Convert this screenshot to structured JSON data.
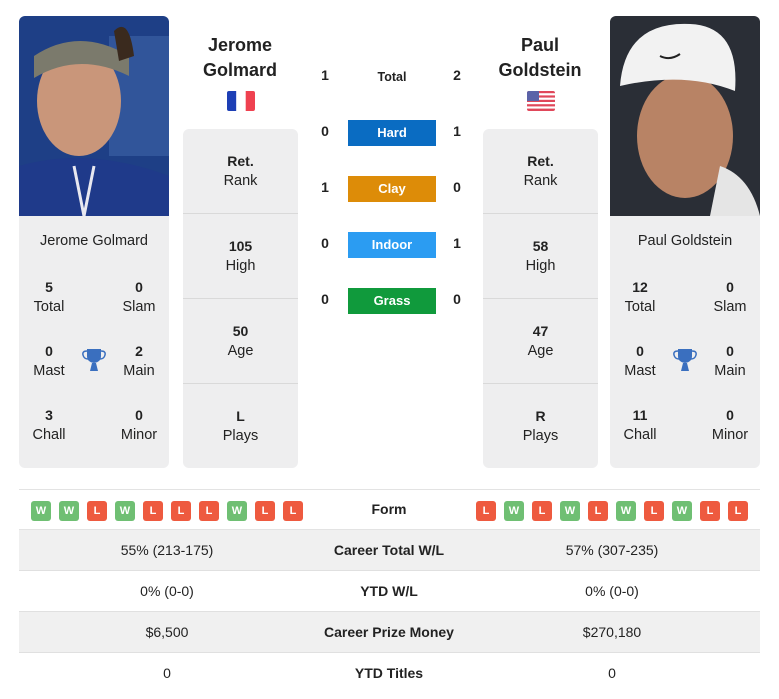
{
  "player1": {
    "name_line1": "Jerome",
    "name_line2": "Golmard",
    "full_name": "Jerome Golmard",
    "country_flag": "france-flag",
    "titles": {
      "total": {
        "value": "5",
        "label": "Total"
      },
      "slam": {
        "value": "0",
        "label": "Slam"
      },
      "mast": {
        "value": "0",
        "label": "Mast"
      },
      "main": {
        "value": "2",
        "label": "Main"
      },
      "chall": {
        "value": "3",
        "label": "Chall"
      },
      "minor": {
        "value": "0",
        "label": "Minor"
      }
    },
    "info": [
      {
        "value": "Ret.",
        "label": "Rank"
      },
      {
        "value": "105",
        "label": "High"
      },
      {
        "value": "50",
        "label": "Age"
      },
      {
        "value": "L",
        "label": "Plays"
      }
    ],
    "form": [
      "W",
      "W",
      "L",
      "W",
      "L",
      "L",
      "L",
      "W",
      "L",
      "L"
    ]
  },
  "player2": {
    "name_line1": "Paul",
    "name_line2": "Goldstein",
    "full_name": "Paul Goldstein",
    "country_flag": "usa-flag",
    "titles": {
      "total": {
        "value": "12",
        "label": "Total"
      },
      "slam": {
        "value": "0",
        "label": "Slam"
      },
      "mast": {
        "value": "0",
        "label": "Mast"
      },
      "main": {
        "value": "0",
        "label": "Main"
      },
      "chall": {
        "value": "11",
        "label": "Chall"
      },
      "minor": {
        "value": "0",
        "label": "Minor"
      }
    },
    "info": [
      {
        "value": "Ret.",
        "label": "Rank"
      },
      {
        "value": "58",
        "label": "High"
      },
      {
        "value": "47",
        "label": "Age"
      },
      {
        "value": "R",
        "label": "Plays"
      }
    ],
    "form": [
      "L",
      "W",
      "L",
      "W",
      "L",
      "W",
      "L",
      "W",
      "L",
      "L"
    ]
  },
  "h2h": [
    {
      "surface": "Total",
      "p1": "1",
      "p2": "2",
      "color": ""
    },
    {
      "surface": "Hard",
      "p1": "0",
      "p2": "1",
      "color": "#0a6cc2"
    },
    {
      "surface": "Clay",
      "p1": "1",
      "p2": "0",
      "color": "#dd8c08"
    },
    {
      "surface": "Indoor",
      "p1": "0",
      "p2": "1",
      "color": "#2b9cf2"
    },
    {
      "surface": "Grass",
      "p1": "0",
      "p2": "0",
      "color": "#109a3c"
    }
  ],
  "form_label": "Form",
  "stats": [
    {
      "label": "Career Total W/L",
      "p1": "55% (213-175)",
      "p2": "57% (307-235)"
    },
    {
      "label": "YTD W/L",
      "p1": "0% (0-0)",
      "p2": "0% (0-0)"
    },
    {
      "label": "Career Prize Money",
      "p1": "$6,500",
      "p2": "$270,180"
    },
    {
      "label": "YTD Titles",
      "p1": "0",
      "p2": "0"
    }
  ],
  "colors": {
    "win": "#6fbf73",
    "loss": "#ee5a3f",
    "trophy": "#3a6fbf",
    "card_bg": "#eeeeef"
  }
}
